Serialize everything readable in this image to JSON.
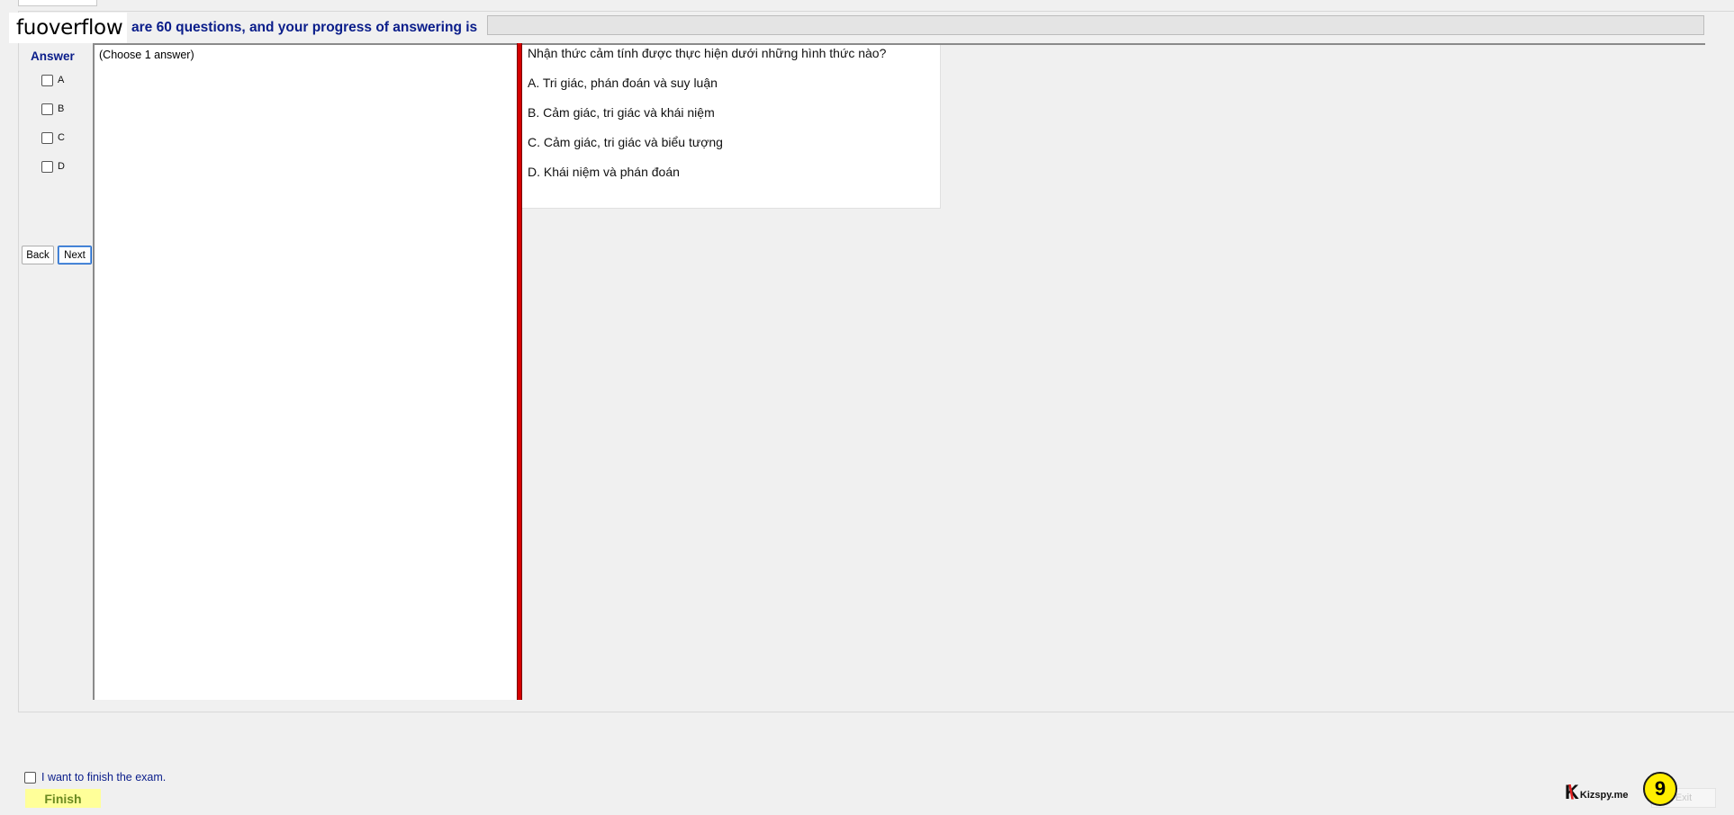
{
  "header": {
    "watermark": "fuoverflow",
    "progress_text": "are 60 questions, and your progress of answering is",
    "progress_value": 0
  },
  "answer_panel": {
    "title": "Answer",
    "options": [
      "A",
      "B",
      "C",
      "D"
    ],
    "back_label": "Back",
    "next_label": "Next"
  },
  "instruction": "(Choose 1 answer)",
  "question": {
    "text": "Nhận thức cảm tính được thực hiện dưới những hình thức nào?",
    "choices": [
      "A.  Tri giác, phán đoán và suy luận",
      "B.  Cảm giác, tri giác và khái niệm",
      "C.  Cảm giác, tri giác và biểu tượng",
      "D.  Khái niệm và phán đoán"
    ]
  },
  "footer": {
    "finish_check_label": "I want to finish the exam.",
    "finish_label": "Finish",
    "exit_label": "Exit",
    "logo_text": "Kizspy.me",
    "badge_number": "9"
  },
  "colors": {
    "accent_text": "#0a1d8a",
    "splitter": "#d40000",
    "finish_bg": "#ffff99",
    "badge_bg": "#ffee00"
  }
}
